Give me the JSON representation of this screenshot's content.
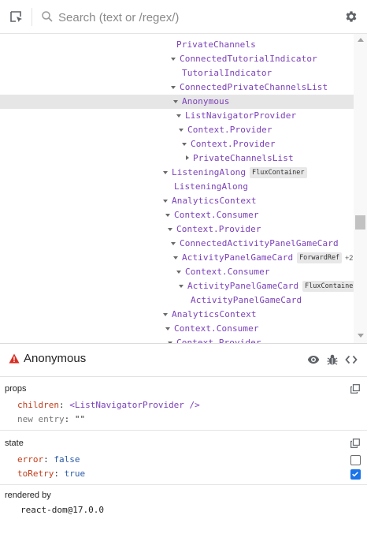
{
  "search": {
    "placeholder": "Search (text or /regex/)"
  },
  "tree": {
    "rows": [
      {
        "name": "PrivateChannels",
        "arrow": "none"
      },
      {
        "name": "ConnectedTutorialIndicator",
        "arrow": "down"
      },
      {
        "name": "TutorialIndicator",
        "arrow": "none"
      },
      {
        "name": "ConnectedPrivateChannelsList",
        "arrow": "down"
      },
      {
        "name": "Anonymous",
        "arrow": "down",
        "selected": true
      },
      {
        "name": "ListNavigatorProvider",
        "arrow": "down"
      },
      {
        "name": "Context.Provider",
        "arrow": "down"
      },
      {
        "name": "Context.Provider",
        "arrow": "down"
      },
      {
        "name": "PrivateChannelsList",
        "arrow": "right"
      },
      {
        "name": "ListeningAlong",
        "arrow": "down",
        "badge": "FluxContainer"
      },
      {
        "name": "ListeningAlong",
        "arrow": "none"
      },
      {
        "name": "AnalyticsContext",
        "arrow": "down"
      },
      {
        "name": "Context.Consumer",
        "arrow": "down"
      },
      {
        "name": "Context.Provider",
        "arrow": "down"
      },
      {
        "name": "ConnectedActivityPanelGameCard",
        "arrow": "down"
      },
      {
        "name": "ActivityPanelGameCard",
        "arrow": "down",
        "badge": "ForwardRef",
        "extra": "+2"
      },
      {
        "name": "Context.Consumer",
        "arrow": "down"
      },
      {
        "name": "ActivityPanelGameCard",
        "arrow": "down",
        "badge": "FluxContainer"
      },
      {
        "name": "ActivityPanelGameCard",
        "arrow": "none"
      },
      {
        "name": "AnalyticsContext",
        "arrow": "down"
      },
      {
        "name": "Context.Consumer",
        "arrow": "down"
      },
      {
        "name": "Context.Provider",
        "arrow": "down"
      }
    ]
  },
  "inspected": {
    "title": "Anonymous"
  },
  "props": {
    "title": "props",
    "children_key": "children",
    "children_value": "<ListNavigatorProvider />",
    "new_entry_key": "new entry",
    "new_entry_value": "\"\""
  },
  "state": {
    "title": "state",
    "entries": [
      {
        "key": "error",
        "value": "false",
        "checked": false
      },
      {
        "key": "toRetry",
        "value": "true",
        "checked": true
      }
    ]
  },
  "rendered_by": {
    "title": "rendered by",
    "renderer": "react-dom@17.0.0"
  },
  "colors": {
    "component": "#7b41b9",
    "key": "#c03d1a",
    "accent": "#1a73e8",
    "warning": "#d93025"
  }
}
